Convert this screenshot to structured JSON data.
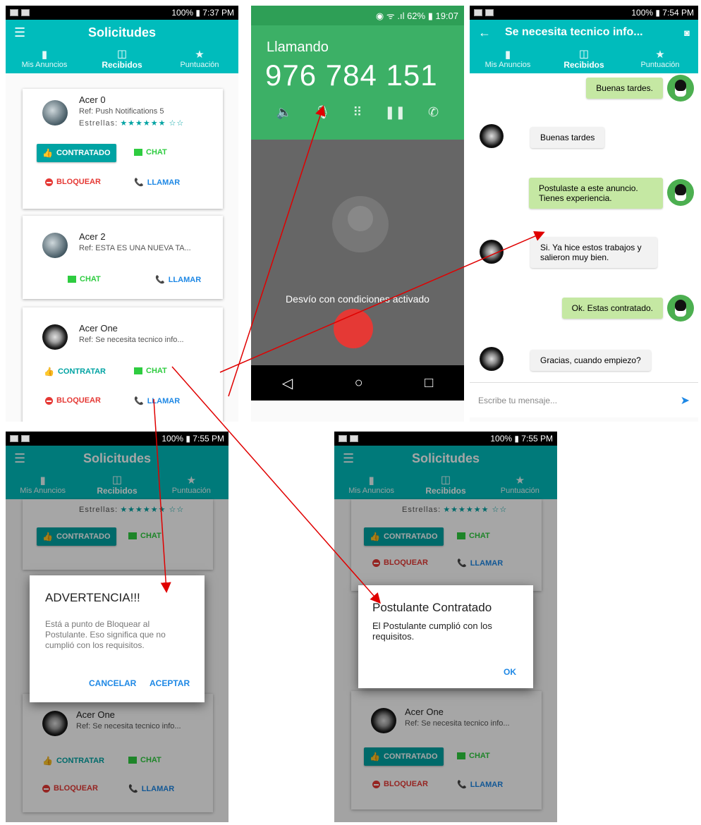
{
  "screen1": {
    "status_time": "100% ▮ 7:37 PM",
    "title": "Solicitudes",
    "tabs": [
      {
        "label": "Mis Anuncios",
        "icon": "book-icon"
      },
      {
        "label": "Recibidos",
        "icon": "open-book-icon"
      },
      {
        "label": "Puntuación",
        "icon": "star-icon"
      }
    ],
    "cards": [
      {
        "name": "Acer 0",
        "ref": "Ref: Push Notifications 5",
        "stars_label": "Estrellas:",
        "stars": "★★★★★★ ☆☆",
        "contratado": "CONTRATADO",
        "chat": "CHAT",
        "bloquear": "BLOQUEAR",
        "llamar": "LLAMAR"
      },
      {
        "name": "Acer 2",
        "ref": "Ref: ESTA ES UNA NUEVA TA...",
        "chat": "CHAT",
        "llamar": "LLAMAR"
      },
      {
        "name": "Acer One",
        "ref": "Ref: Se necesita tecnico info...",
        "contratar": "CONTRATAR",
        "chat": "CHAT",
        "bloquear": "BLOQUEAR",
        "llamar": "LLAMAR"
      }
    ]
  },
  "call": {
    "status": "◉ ᯤ .ıl 62% ▮ 19:07",
    "label": "Llamando",
    "number": "976 784 151",
    "message": "Desvío con condiciones activado"
  },
  "chat": {
    "status_time": "100% ▮ 7:54 PM",
    "title": "Se necesita tecnico info...",
    "tabs": [
      "Mis Anuncios",
      "Recibidos",
      "Puntuación"
    ],
    "messages": [
      {
        "from": "me",
        "text": "Buenas tardes."
      },
      {
        "from": "them",
        "text": "Buenas tardes"
      },
      {
        "from": "me",
        "text": "Postulaste a este anuncio. Tienes experiencia."
      },
      {
        "from": "them",
        "text": "Si. Ya hice estos trabajos y salieron muy bien."
      },
      {
        "from": "me",
        "text": "Ok. Estas contratado."
      },
      {
        "from": "them",
        "text": "Gracias, cuando empiezo?"
      }
    ],
    "input_placeholder": "Escribe tu mensaje..."
  },
  "screen4": {
    "status_time": "100% ▮ 7:55 PM",
    "title": "Solicitudes",
    "stars_label": "Estrellas:",
    "stars": "★★★★★★ ☆☆",
    "contratado": "CONTRATADO",
    "chat": "CHAT",
    "dialog": {
      "title": "ADVERTENCIA!!!",
      "body": "Está a punto de Bloquear al Postulante. Eso significa que no cumplió con los requisitos.",
      "cancel": "CANCELAR",
      "accept": "ACEPTAR"
    },
    "card": {
      "name": "Acer One",
      "ref": "Ref: Se necesita tecnico info...",
      "contratar": "CONTRATAR",
      "chat": "CHAT",
      "bloquear": "BLOQUEAR",
      "llamar": "LLAMAR"
    }
  },
  "screen5": {
    "status_time": "100% ▮ 7:55 PM",
    "title": "Solicitudes",
    "stars_label": "Estrellas:",
    "stars": "★★★★★★ ☆☆",
    "contratado": "CONTRATADO",
    "chat": "CHAT",
    "bloquear": "BLOQUEAR",
    "llamar": "LLAMAR",
    "dialog": {
      "title": "Postulante Contratado",
      "body": "El Postulante cumplió con los requisitos.",
      "ok": "OK"
    },
    "card": {
      "name": "Acer One",
      "ref": "Ref: Se necesita tecnico info...",
      "contratado": "CONTRATADO",
      "chat": "CHAT",
      "bloquear": "BLOQUEAR",
      "llamar": "LLAMAR"
    }
  },
  "tab_labels": [
    "Mis Anuncios",
    "Recibidos",
    "Puntuación"
  ]
}
